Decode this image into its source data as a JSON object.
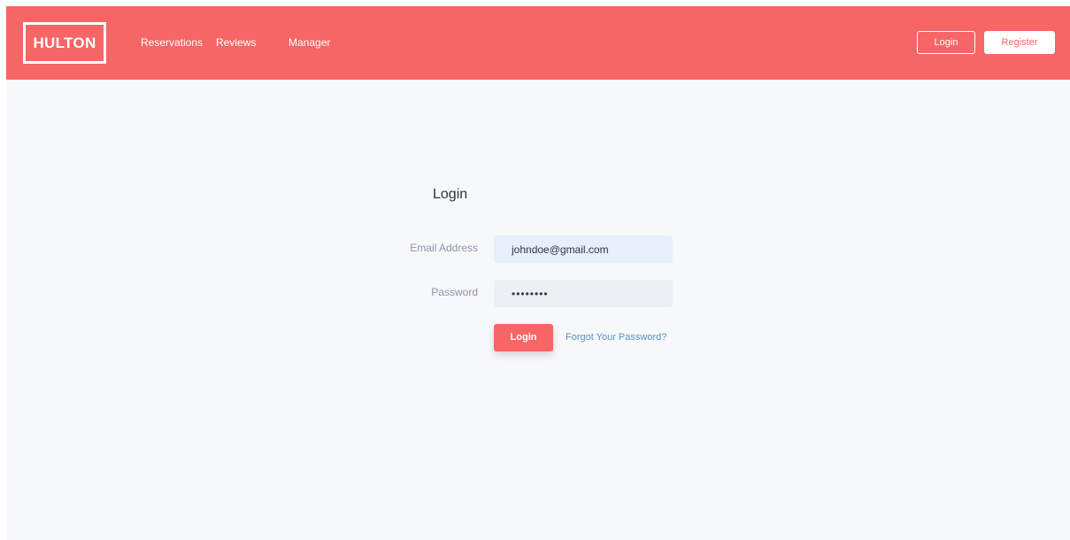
{
  "navbar": {
    "brand": "HULTON",
    "links": [
      "Reservations",
      "Reviews",
      "Manager"
    ],
    "login_button": "Login",
    "register_button": "Register"
  },
  "login_form": {
    "title": "Login",
    "email_label": "Email Address",
    "email_value": "johndoe@gmail.com",
    "password_label": "Password",
    "password_value": "••••••••",
    "submit_label": "Login",
    "forgot_link": "Forgot Your Password?"
  },
  "colors": {
    "brand": "#f66666",
    "background": "#f7f8fa",
    "link": "#5a91c8"
  }
}
